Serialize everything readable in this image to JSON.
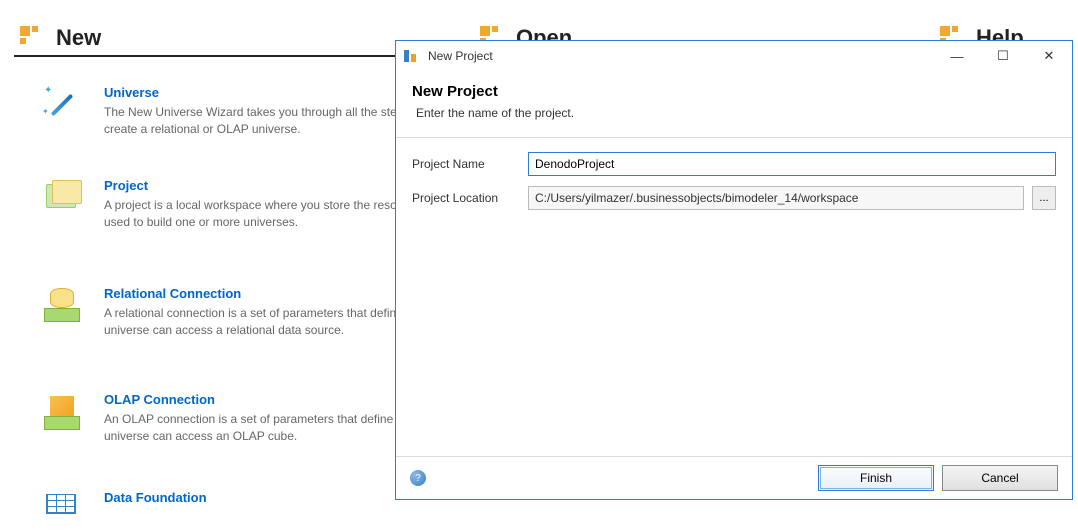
{
  "tabs": {
    "new": "New",
    "open": "Open",
    "help": "Help"
  },
  "items": {
    "universe": {
      "title": "Universe",
      "desc": "The New Universe Wizard takes you through all the steps to create a relational or OLAP universe."
    },
    "project": {
      "title": "Project",
      "desc": "A project is a local workspace where you store the resources used to build one or more universes."
    },
    "relconn": {
      "title": "Relational Connection",
      "desc": "A relational connection is a set of parameters that define how a universe can access a relational data source."
    },
    "olap": {
      "title": "OLAP Connection",
      "desc": "An OLAP connection is a set of parameters that define how a universe can access an OLAP cube."
    },
    "dfound": {
      "title": "Data Foundation",
      "desc": ""
    }
  },
  "dialog": {
    "window_title": "New Project",
    "heading": "New Project",
    "subheading": "Enter the name of the project.",
    "name_label": "Project Name",
    "name_value": "DenodoProject",
    "location_label": "Project Location",
    "location_value": "C:/Users/yilmazer/.businessobjects/bimodeler_14/workspace",
    "browse_label": "...",
    "help_label": "?",
    "finish": "Finish",
    "cancel": "Cancel",
    "min": "—",
    "max": "☐",
    "close": "✕"
  }
}
